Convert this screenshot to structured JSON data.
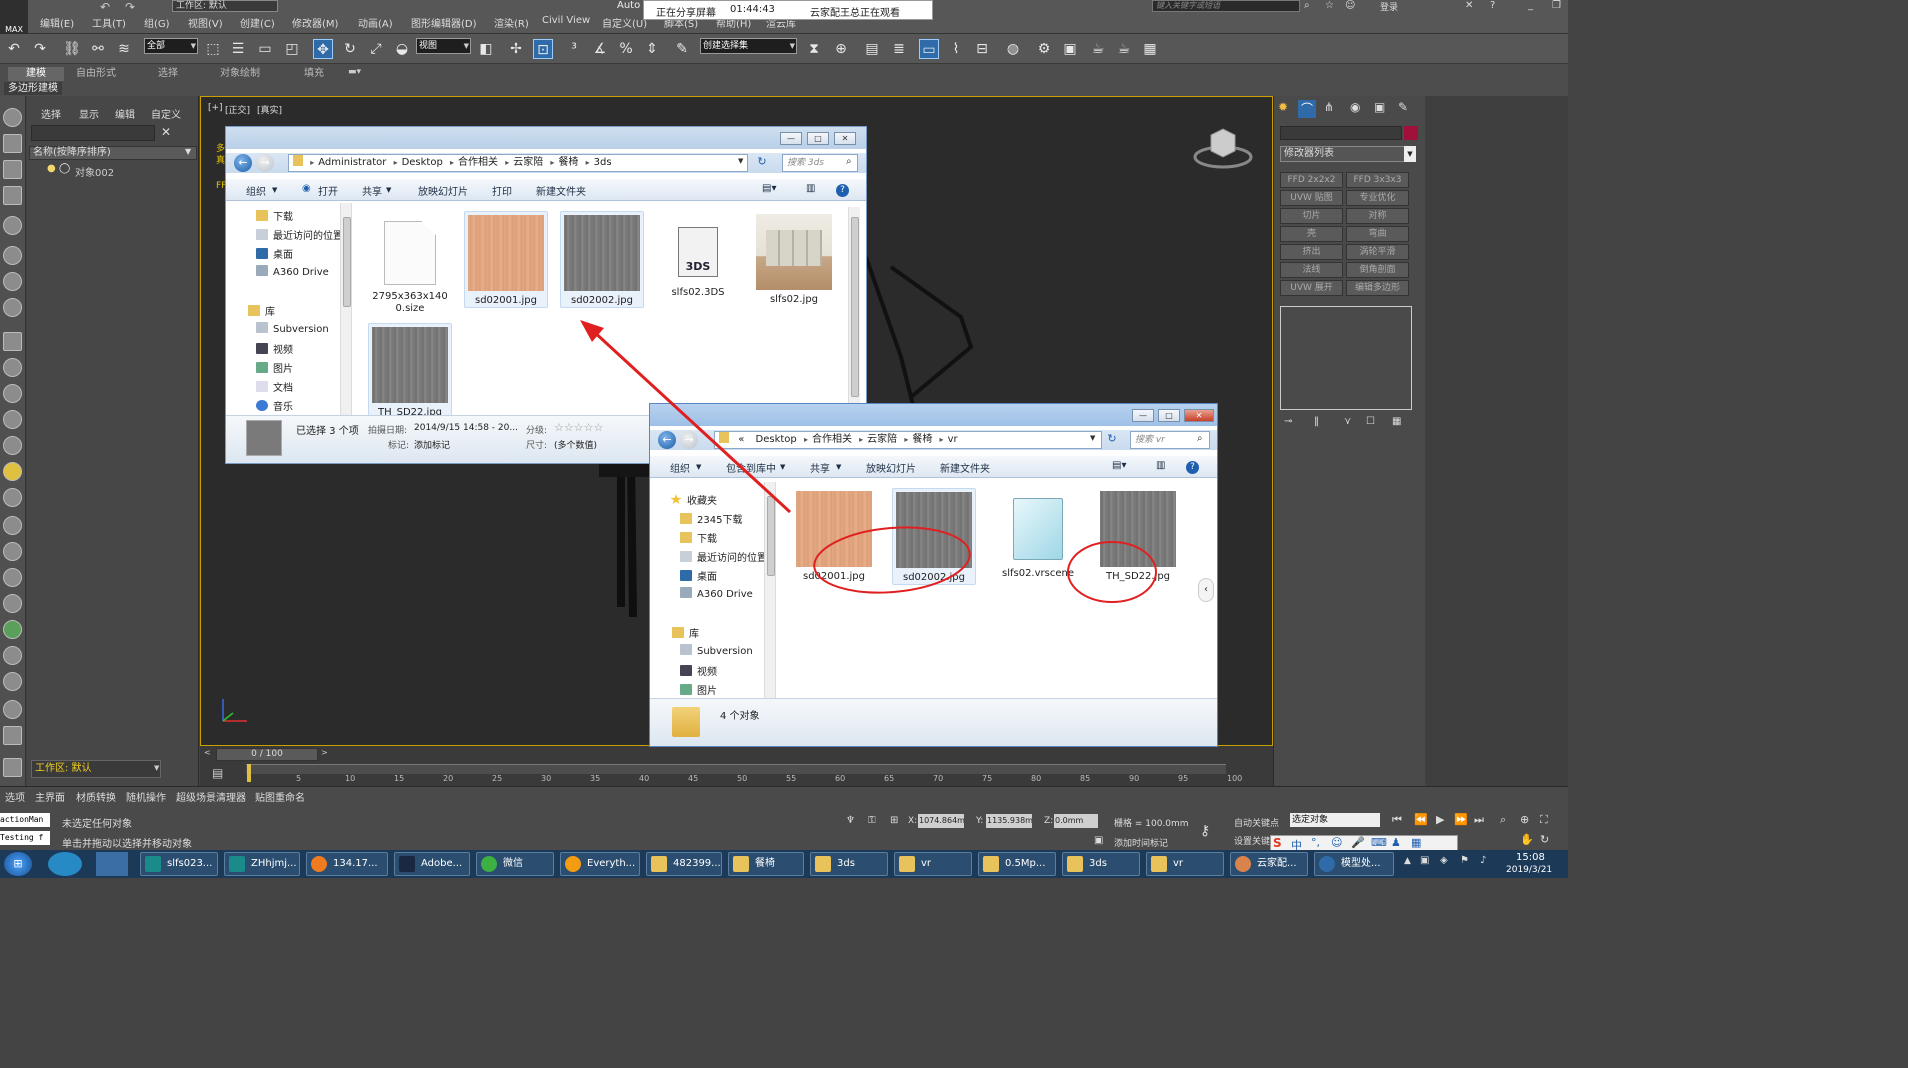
{
  "app": {
    "logo_text": "MAX",
    "workspace_label": "工作区: 默认",
    "menus": [
      "编辑(E)",
      "工具(T)",
      "组(G)",
      "视图(V)",
      "创建(C)",
      "修改器(M)",
      "动画(A)",
      "图形编辑器(D)",
      "渲染(R)",
      "Civil View",
      "自定义(U)",
      "脚本(S)",
      "帮助(H)",
      "渲云库"
    ],
    "title_fragment": "Auto",
    "search_placeholder": "键入关键字或短语",
    "login_label": "登录"
  },
  "share_banner": {
    "status": "正在分享屏幕",
    "time": "01:44:43",
    "viewer": "云家配王总正在观看"
  },
  "toolbar": {
    "filter_value": "全部",
    "refcoord_value": "视图",
    "selection_set_value": "创建选择集"
  },
  "ribbon": {
    "tabs": [
      "建模",
      "自由形式",
      "选择",
      "对象绘制",
      "填充"
    ],
    "active_tab": "建模",
    "sub_label": "多边形建模"
  },
  "scene_explorer": {
    "tabs": [
      "选择",
      "显示",
      "编辑",
      "自定义"
    ],
    "column_header": "名称(按降序排序)",
    "object_name": "对象002",
    "workspace_value": "工作区: 默认"
  },
  "viewport": {
    "label_parts": [
      "[+]",
      "[正交]",
      "[真实]"
    ],
    "side_labels": [
      "多",
      "真",
      "FF"
    ]
  },
  "command_panel": {
    "modifier_list": "修改器列表",
    "buttons": [
      "FFD 2x2x2",
      "FFD 3x3x3",
      "UVW 贴图",
      "专业优化",
      "切片",
      "对称",
      "壳",
      "弯曲",
      "挤出",
      "涡轮平滑",
      "法线",
      "倒角剖面",
      "UVW 展开",
      "编辑多边形"
    ]
  },
  "timeline": {
    "frame_display": "0 / 100",
    "ticks": [
      "5",
      "10",
      "15",
      "20",
      "25",
      "30",
      "35",
      "40",
      "45",
      "50",
      "55",
      "60",
      "65",
      "70",
      "75",
      "80",
      "85",
      "90",
      "95",
      "100"
    ]
  },
  "status": {
    "tabs": [
      "选项",
      "主界面",
      "材质转换",
      "随机操作",
      "超级场景清理器",
      "贴图重命名"
    ],
    "no_selection": "未选定任何对象",
    "prompt": "单击并拖动以选择并移动对象",
    "script_box_1": "actionMan",
    "script_box_2": "Testing f",
    "x_label": "X:",
    "x_value": "1074.864m",
    "y_label": "Y:",
    "y_value": "1135.938m",
    "z_label": "Z:",
    "z_value": "0.0mm",
    "grid": "栅格 = 100.0mm",
    "auto_key": "自动关键点",
    "selected_obj": "选定对象",
    "set_key": "设置关键点",
    "add_time_tag": "添加时间标记"
  },
  "explorer_3ds": {
    "breadcrumb": [
      "Administrator",
      "Desktop",
      "合作相关",
      "云家陪",
      "餐椅",
      "3ds"
    ],
    "search_placeholder": "搜索 3ds",
    "commands": [
      "组织",
      "打开",
      "共享",
      "放映幻灯片",
      "打印",
      "新建文件夹"
    ],
    "nav": [
      "下载",
      "最近访问的位置",
      "桌面",
      "A360 Drive",
      "库",
      "Subversion",
      "视频",
      "图片",
      "文档",
      "音乐"
    ],
    "files": [
      {
        "name": "2795x363x1400.size",
        "kind": "doc"
      },
      {
        "name": "sd02001.jpg",
        "kind": "wood"
      },
      {
        "name": "sd02002.jpg",
        "kind": "gray"
      },
      {
        "name": "slfs02.3DS",
        "kind": "tds",
        "glyph": "3DS"
      },
      {
        "name": "slfs02.jpg",
        "kind": "room"
      },
      {
        "name": "TH_SD22.jpg",
        "kind": "gray"
      }
    ],
    "details": {
      "selected": "已选择 3 个项",
      "date_label": "拍摄日期:",
      "date_value": "2014/9/15 14:58 - 20...",
      "rating_label": "分级:",
      "tag_label": "标记:",
      "tag_value": "添加标记",
      "size_label": "尺寸:",
      "size_value": "(多个数值)"
    }
  },
  "explorer_vr": {
    "breadcrumb": [
      "«",
      "Desktop",
      "合作相关",
      "云家陪",
      "餐椅",
      "vr"
    ],
    "search_placeholder": "搜索 vr",
    "commands": [
      "组织",
      "包含到库中",
      "共享",
      "放映幻灯片",
      "新建文件夹"
    ],
    "nav": [
      "收藏夹",
      "2345下载",
      "下载",
      "最近访问的位置",
      "桌面",
      "A360 Drive",
      "库",
      "Subversion",
      "视频",
      "图片"
    ],
    "files": [
      {
        "name": "sd02001.jpg",
        "kind": "wood"
      },
      {
        "name": "sd02002.jpg",
        "kind": "gray"
      },
      {
        "name": "slfs02.vrscene",
        "kind": "vrs"
      },
      {
        "name": "TH_SD22.jpg",
        "kind": "gray"
      }
    ],
    "details": {
      "count": "4 个对象"
    }
  },
  "taskbar": {
    "items": [
      "slfs023...",
      "ZHhjmj...",
      "134.17...",
      "Adobe...",
      "微信",
      "Everyth...",
      "482399...",
      "餐椅",
      "3ds",
      "vr",
      "0.5Mp...",
      "3ds",
      "vr",
      "云家配...",
      "模型处..."
    ],
    "time": "15:08",
    "date": "2019/3/21",
    "ime": "中"
  },
  "colors": {
    "annotation_red": "#e02020",
    "selection_blue": "#2f6ba8",
    "viewport_border": "#c8a000"
  }
}
